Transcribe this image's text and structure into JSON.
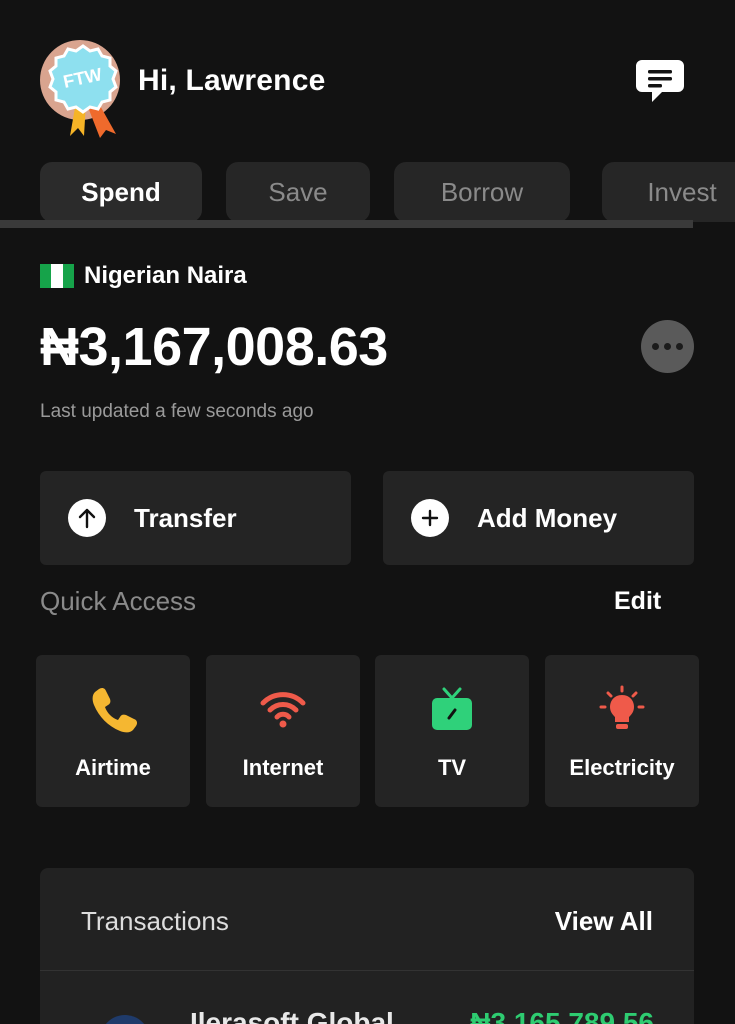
{
  "header": {
    "greeting": "Hi, Lawrence",
    "avatar_badge_text": "FTW"
  },
  "tabs": [
    {
      "label": "Spend",
      "active": true
    },
    {
      "label": "Save",
      "active": false
    },
    {
      "label": "Borrow",
      "active": false
    },
    {
      "label": "Invest",
      "active": false
    }
  ],
  "balance": {
    "currency_name": "Nigerian Naira",
    "amount": "₦3,167,008.63",
    "updated_text": "Last updated a few seconds ago"
  },
  "actions": {
    "transfer_label": "Transfer",
    "add_money_label": "Add Money"
  },
  "quick_access": {
    "title": "Quick Access",
    "edit_label": "Edit",
    "items": [
      {
        "label": "Airtime",
        "icon": "phone-icon",
        "color": "#f5b731"
      },
      {
        "label": "Internet",
        "icon": "wifi-icon",
        "color": "#ef5a4a"
      },
      {
        "label": "TV",
        "icon": "tv-icon",
        "color": "#2fd17a"
      },
      {
        "label": "Electricity",
        "icon": "lightbulb-icon",
        "color": "#ef5a4a"
      }
    ]
  },
  "transactions": {
    "title": "Transactions",
    "view_all_label": "View All",
    "rows": [
      {
        "name": "Ilerasoft Global",
        "amount": "₦3,165,789.56"
      }
    ]
  },
  "colors": {
    "background": "#121212",
    "card": "#242424",
    "credit": "#2ecc71"
  }
}
